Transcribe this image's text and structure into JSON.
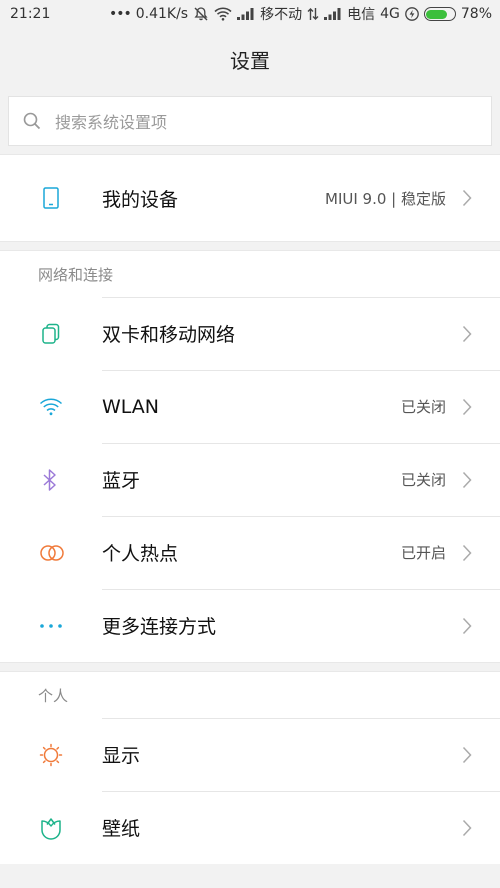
{
  "status": {
    "time": "21:21",
    "dots": "•••",
    "speed": "0.41K/s",
    "carrier1": "移不动",
    "carrier2": "电信",
    "network": "4G",
    "battery": "78%",
    "battery_level": 0.78
  },
  "header": {
    "title": "设置"
  },
  "search": {
    "placeholder": "搜索系统设置项"
  },
  "device": {
    "label": "我的设备",
    "value": "MIUI 9.0 | 稳定版"
  },
  "network_section": {
    "title": "网络和连接",
    "items": [
      {
        "label": "双卡和移动网络",
        "value": "",
        "icon": "sim-card-icon",
        "color": "#1db38a"
      },
      {
        "label": "WLAN",
        "value": "已关闭",
        "icon": "wifi-icon",
        "color": "#1aa7d8"
      },
      {
        "label": "蓝牙",
        "value": "已关闭",
        "icon": "bluetooth-icon",
        "color": "#9b7ad8"
      },
      {
        "label": "个人热点",
        "value": "已开启",
        "icon": "hotspot-icon",
        "color": "#f07a3a"
      },
      {
        "label": "更多连接方式",
        "value": "",
        "icon": "more-dots-icon",
        "color": "#1aa7d8"
      }
    ]
  },
  "personal_section": {
    "title": "个人",
    "items": [
      {
        "label": "显示",
        "value": "",
        "icon": "sun-icon",
        "color": "#f07a3a"
      },
      {
        "label": "壁纸",
        "value": "",
        "icon": "wallpaper-icon",
        "color": "#1db38a"
      }
    ]
  },
  "accent": "#1aa7d8"
}
